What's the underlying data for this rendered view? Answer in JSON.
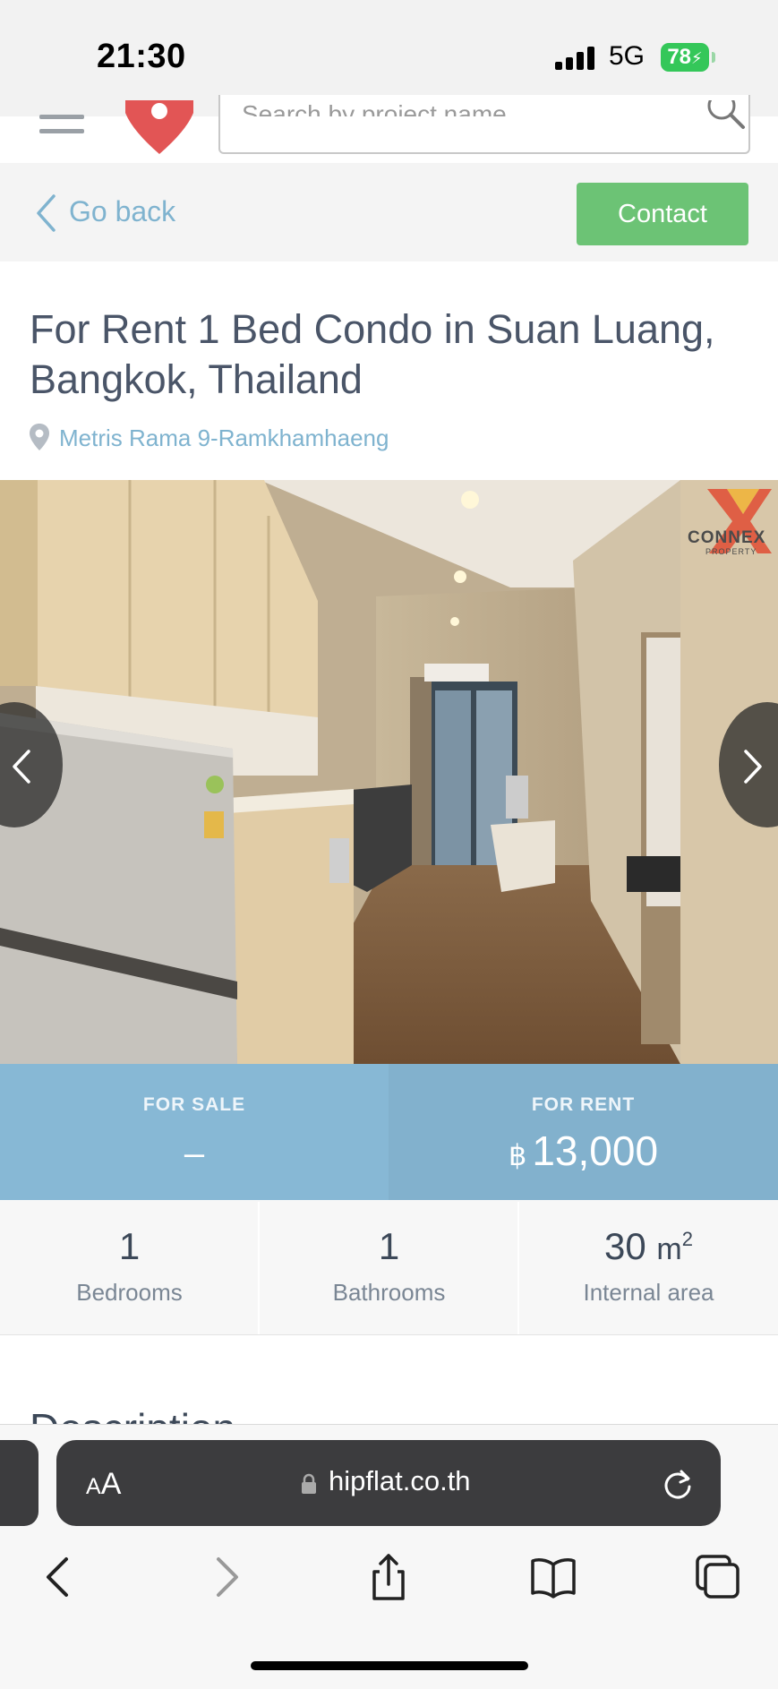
{
  "status_bar": {
    "time": "21:30",
    "network": "5G",
    "battery": "78"
  },
  "site_header": {
    "search_placeholder": "Search by project name"
  },
  "nav": {
    "back_label": "Go back",
    "contact_label": "Contact"
  },
  "listing": {
    "title": "For Rent 1 Bed Condo in Suan Luang, Bangkok, Thailand",
    "project": "Metris Rama 9-Ramkhamhaeng",
    "photo_watermark": "CONNEX",
    "photo_watermark_sub": "PROPERTY"
  },
  "prices": {
    "sale_label": "FOR SALE",
    "sale_value": "–",
    "rent_label": "FOR RENT",
    "currency_symbol": "฿",
    "rent_value": "13,000"
  },
  "stats": [
    {
      "value": "1",
      "label": "Bedrooms"
    },
    {
      "value": "1",
      "label": "Bathrooms"
    },
    {
      "value": "30",
      "unit": "m",
      "unit_sup": "2",
      "label": "Internal area"
    }
  ],
  "description_heading": "Description",
  "browser": {
    "text_size_small": "A",
    "text_size_large": "A",
    "url": "hipflat.co.th"
  },
  "colors": {
    "contact_green": "#6cc375",
    "link_blue": "#7fb3cf",
    "price_blue": "#87b8d5"
  }
}
